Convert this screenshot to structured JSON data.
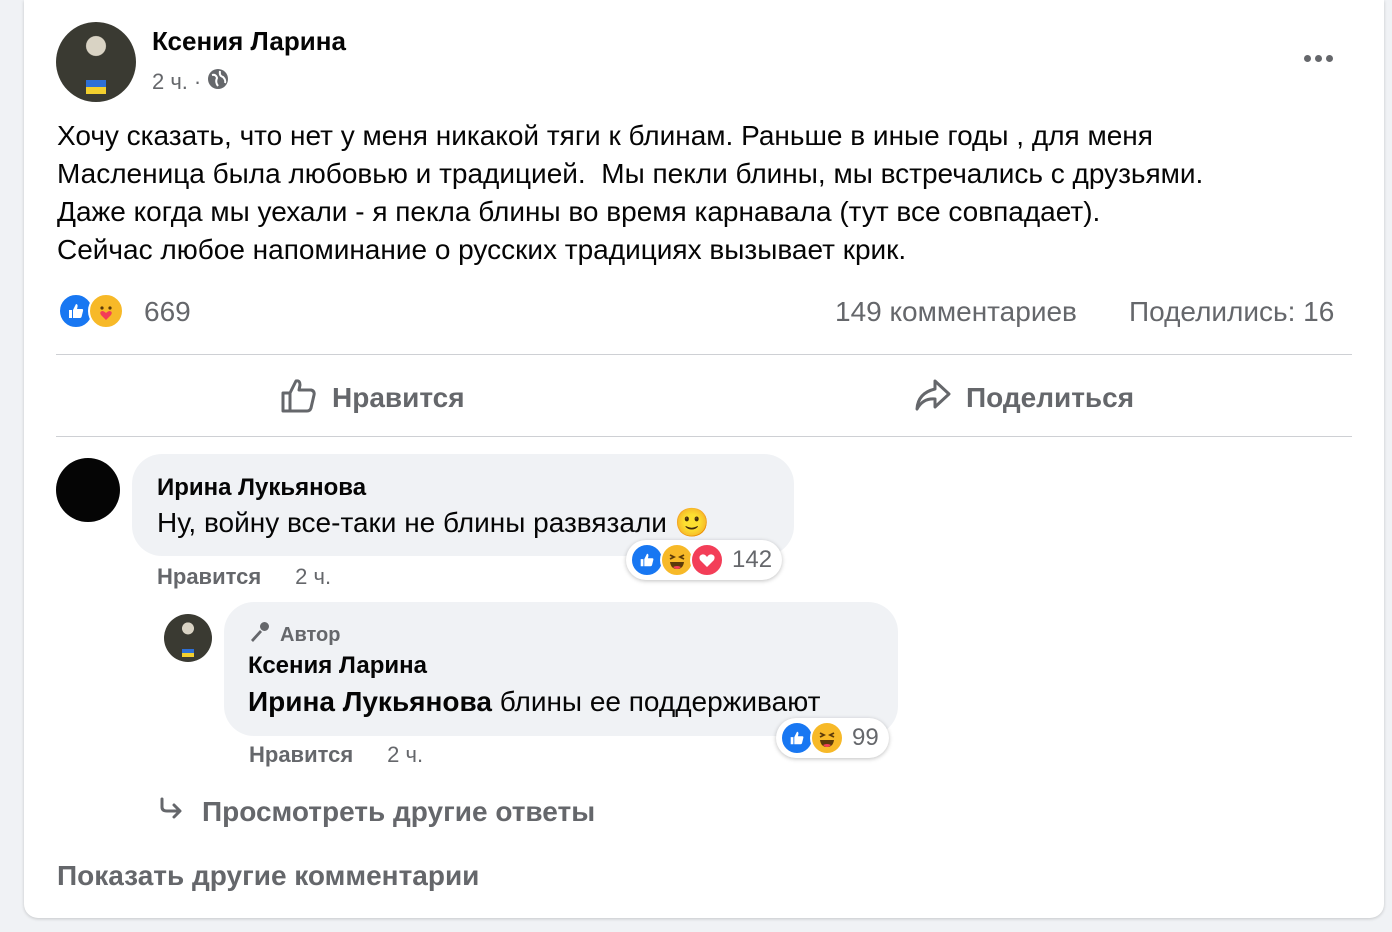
{
  "post": {
    "author": "Ксения Ларина",
    "time": "2 ч.",
    "separator": "·",
    "text_lines": [
      "Хочу сказать, что нет у меня никакой тяги к блинам. Раньше в иные годы , для меня",
      "Масленица была любовью и традицией.  Мы пекли блины, мы встречались с друзьями.",
      "Даже когда мы уехали - я пекла блины во время карнавала (тут все совпадает).",
      "Сейчас любое напоминание о русских традициях вызывает крик."
    ],
    "reaction_count": "669",
    "comments_count": "149 комментариев",
    "shares_count": "Поделились: 16",
    "reaction_icons": [
      "like-icon",
      "care-icon"
    ]
  },
  "actions": {
    "like_label": "Нравится",
    "share_label": "Поделиться"
  },
  "comments": [
    {
      "name": "Ирина Лукьянова",
      "text": "Ну, войну все-таки не блины развязали",
      "emoji": "🙂",
      "like_label": "Нравится",
      "time": "2 ч.",
      "reaction_count": "142",
      "reaction_icons": [
        "like-icon",
        "haha-icon",
        "love-icon"
      ]
    }
  ],
  "reply": {
    "badge": "Автор",
    "name": "Ксения Ларина",
    "mention": "Ирина Лукьянова",
    "text": " блины ее поддерживают",
    "like_label": "Нравится",
    "time": "2 ч.",
    "reaction_count": "99",
    "reaction_icons": [
      "like-icon",
      "haha-icon"
    ]
  },
  "view_more_replies": "Просмотреть другие ответы",
  "show_more_comments": "Показать другие комментарии",
  "colors": {
    "like_blue": "#1877f2",
    "haha_yellow": "#f7b928",
    "love_red": "#f33e58",
    "secondary_text": "#65676b",
    "bubble_bg": "#f0f2f5"
  }
}
